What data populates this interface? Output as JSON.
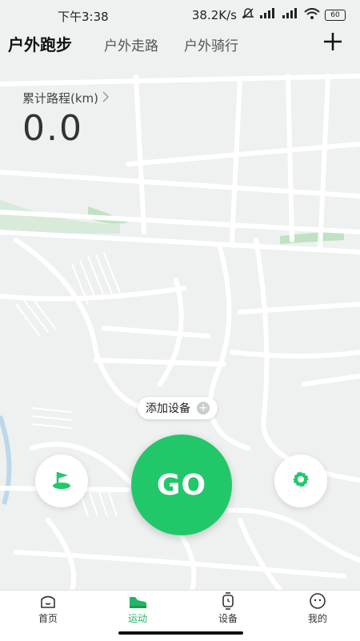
{
  "status_bar": {
    "time": "下午3:38",
    "speed": "38.2K/s",
    "battery": "60"
  },
  "tabs": [
    {
      "label": "户外跑步",
      "active": true
    },
    {
      "label": "户外走路",
      "active": false
    },
    {
      "label": "户外骑行",
      "active": false
    }
  ],
  "stats": {
    "label": "累计路程(km)",
    "value": "0.0"
  },
  "add_device": {
    "label": "添加设备"
  },
  "go_button": {
    "label": "GO"
  },
  "bottom_nav": [
    {
      "label": "首页",
      "icon": "home-icon",
      "active": false
    },
    {
      "label": "运动",
      "icon": "sport-shoe-icon",
      "active": true
    },
    {
      "label": "设备",
      "icon": "watch-icon",
      "active": false
    },
    {
      "label": "我的",
      "icon": "profile-icon",
      "active": false
    }
  ],
  "colors": {
    "accent": "#22c76a",
    "active_nav": "#21b565",
    "map_bg": "#eef1f0",
    "park": "#bfe3c2"
  }
}
